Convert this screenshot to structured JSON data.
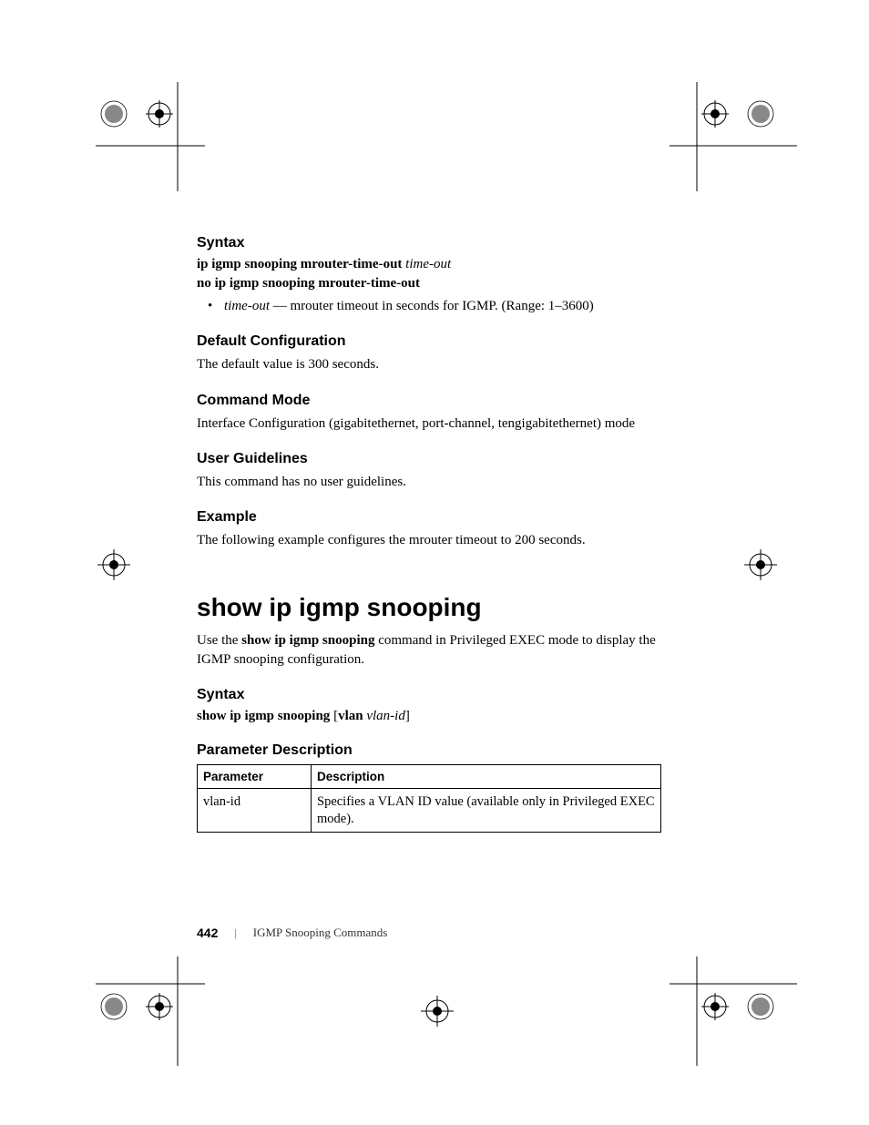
{
  "sections": {
    "syntax1": {
      "heading": "Syntax",
      "line1_bold": "ip igmp snooping mrouter-time-out ",
      "line1_italic": "time-out",
      "line2_bold": "no ip igmp snooping mrouter-time-out",
      "bullet_italic": "time-out",
      "bullet_text": " — mrouter timeout in seconds for IGMP. (Range: 1–3600)"
    },
    "default_config": {
      "heading": "Default Configuration",
      "text": "The default value is 300 seconds."
    },
    "command_mode": {
      "heading": "Command Mode",
      "text": "Interface Configuration (gigabitethernet, port-channel, tengigabitethernet) mode"
    },
    "user_guidelines": {
      "heading": "User Guidelines",
      "text": "This command has no user guidelines."
    },
    "example": {
      "heading": "Example",
      "text": "The following example configures the mrouter timeout to 200 seconds."
    },
    "main_heading": "show ip igmp snooping",
    "intro": {
      "pre": "Use the ",
      "bold": "show ip igmp snooping",
      "post": " command in Privileged EXEC mode to display the IGMP snooping configuration."
    },
    "syntax2": {
      "heading": "Syntax",
      "bold1": "show ip igmp snooping",
      "mid": " [",
      "bold2": "vlan",
      "space": " ",
      "italic": "vlan-id",
      "end": "]"
    },
    "param_desc": {
      "heading": "Parameter Description",
      "th1": "Parameter",
      "th2": "Description",
      "row1_param": "vlan-id",
      "row1_desc": "Specifies a VLAN ID value (available only in Privileged EXEC mode)."
    }
  },
  "footer": {
    "page_number": "442",
    "title": "IGMP Snooping Commands"
  }
}
